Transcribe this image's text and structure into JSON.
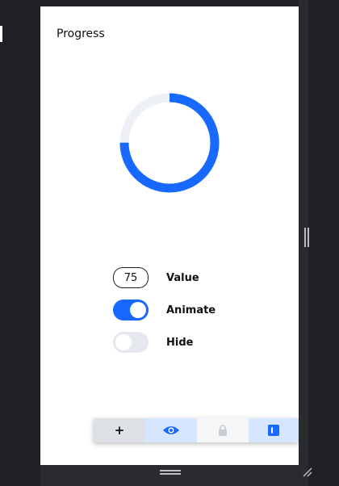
{
  "panel": {
    "title": "Progress"
  },
  "progress": {
    "value": 75,
    "color": "#1769ff",
    "track_color": "#edf1f6"
  },
  "controls": {
    "value": {
      "label": "Value",
      "display": "75"
    },
    "animate": {
      "label": "Animate",
      "on": true
    },
    "hide": {
      "label": "Hide",
      "on": false
    }
  },
  "toolbar": {
    "add_label": "+",
    "items": [
      "plus-icon",
      "eye-icon",
      "lock-icon",
      "frame-icon"
    ]
  },
  "colors": {
    "accent": "#1769ff",
    "toggle_off": "#e5e9ef"
  }
}
